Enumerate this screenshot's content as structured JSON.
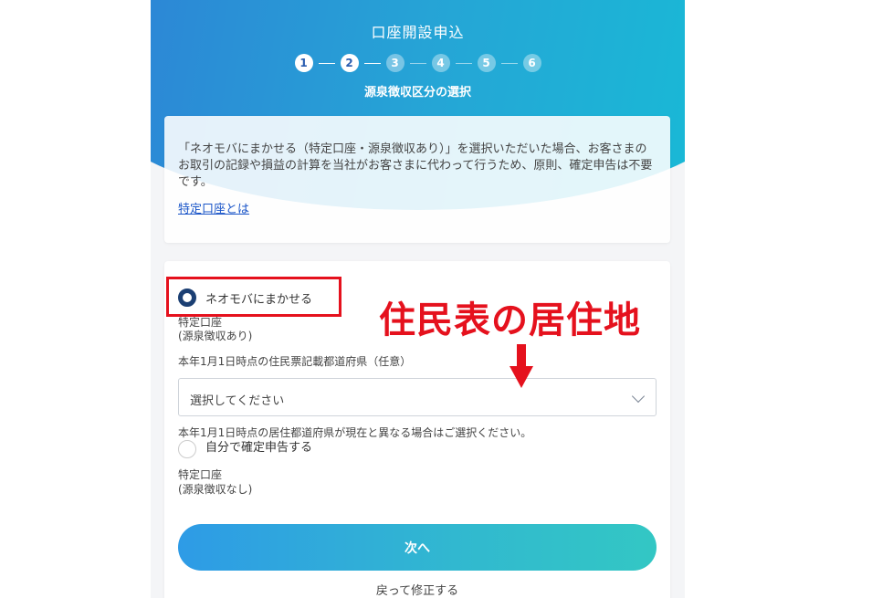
{
  "header": {
    "title": "口座開設申込",
    "steps": [
      "1",
      "2",
      "3",
      "4",
      "5",
      "6"
    ],
    "current_step": 2,
    "subtitle": "源泉徴収区分の選択"
  },
  "info": {
    "text": "「ネオモバにまかせる（特定口座・源泉徴収あり）」を選択いただいた場合、お客さまのお取引の記録や損益の計算を当社がお客さまに代わって行うため、原則、確定申告は不要です。",
    "link": "特定口座とは"
  },
  "options": [
    {
      "label": "ネオモバにまかせる",
      "selected": true,
      "desc_line1": "特定口座",
      "desc_line2": "(源泉徴収あり)"
    },
    {
      "label": "自分で確定申告する",
      "selected": false,
      "desc_line1": "特定口座",
      "desc_line2": "(源泉徴収なし)"
    }
  ],
  "prefecture": {
    "label": "本年1月1日時点の住民票記載都道府県（任意）",
    "placeholder": "選択してください",
    "note": "本年1月1日時点の居住都道府県が現在と異なる場合はご選択ください。"
  },
  "actions": {
    "next": "次へ",
    "back": "戻って修正する"
  },
  "annotation": {
    "text": "住民表の居住地",
    "color": "#e5111d"
  }
}
